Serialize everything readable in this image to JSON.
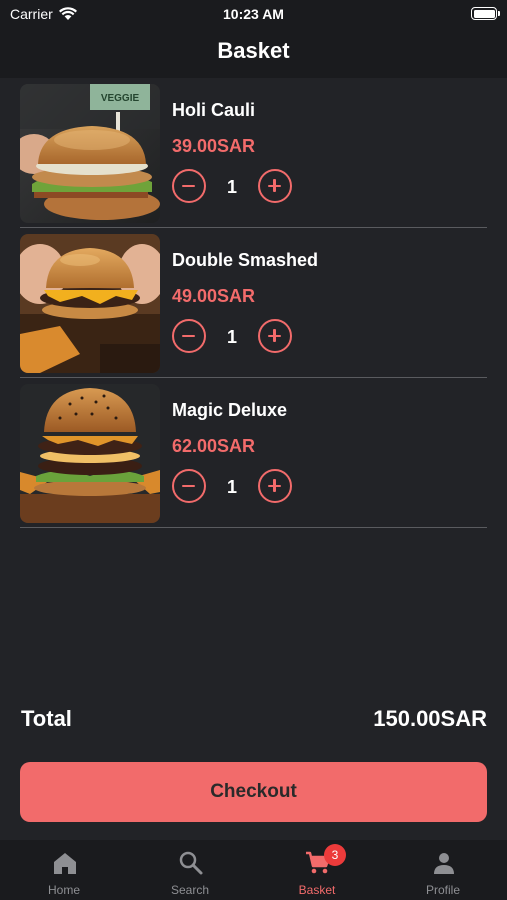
{
  "status_bar": {
    "carrier": "Carrier",
    "time": "10:23 AM"
  },
  "header": {
    "title": "Basket"
  },
  "items": [
    {
      "name": "Holi Cauli",
      "price": "39.00SAR",
      "quantity": "1",
      "image_flag": "VEGGIE"
    },
    {
      "name": "Double Smashed",
      "price": "49.00SAR",
      "quantity": "1"
    },
    {
      "name": "Magic Deluxe",
      "price": "62.00SAR",
      "quantity": "1"
    }
  ],
  "summary": {
    "total_label": "Total",
    "total_value": "150.00SAR"
  },
  "checkout": {
    "label": "Checkout"
  },
  "tabs": [
    {
      "label": "Home",
      "icon": "home-icon"
    },
    {
      "label": "Search",
      "icon": "search-icon"
    },
    {
      "label": "Basket",
      "icon": "cart-icon",
      "badge": "3",
      "active": true
    },
    {
      "label": "Profile",
      "icon": "person-icon"
    }
  ],
  "colors": {
    "accent": "#f26b6b",
    "background": "#222327",
    "bar_background": "#1a1b1e",
    "inactive_tab": "#8e8f93",
    "badge": "#ec3b3b"
  }
}
